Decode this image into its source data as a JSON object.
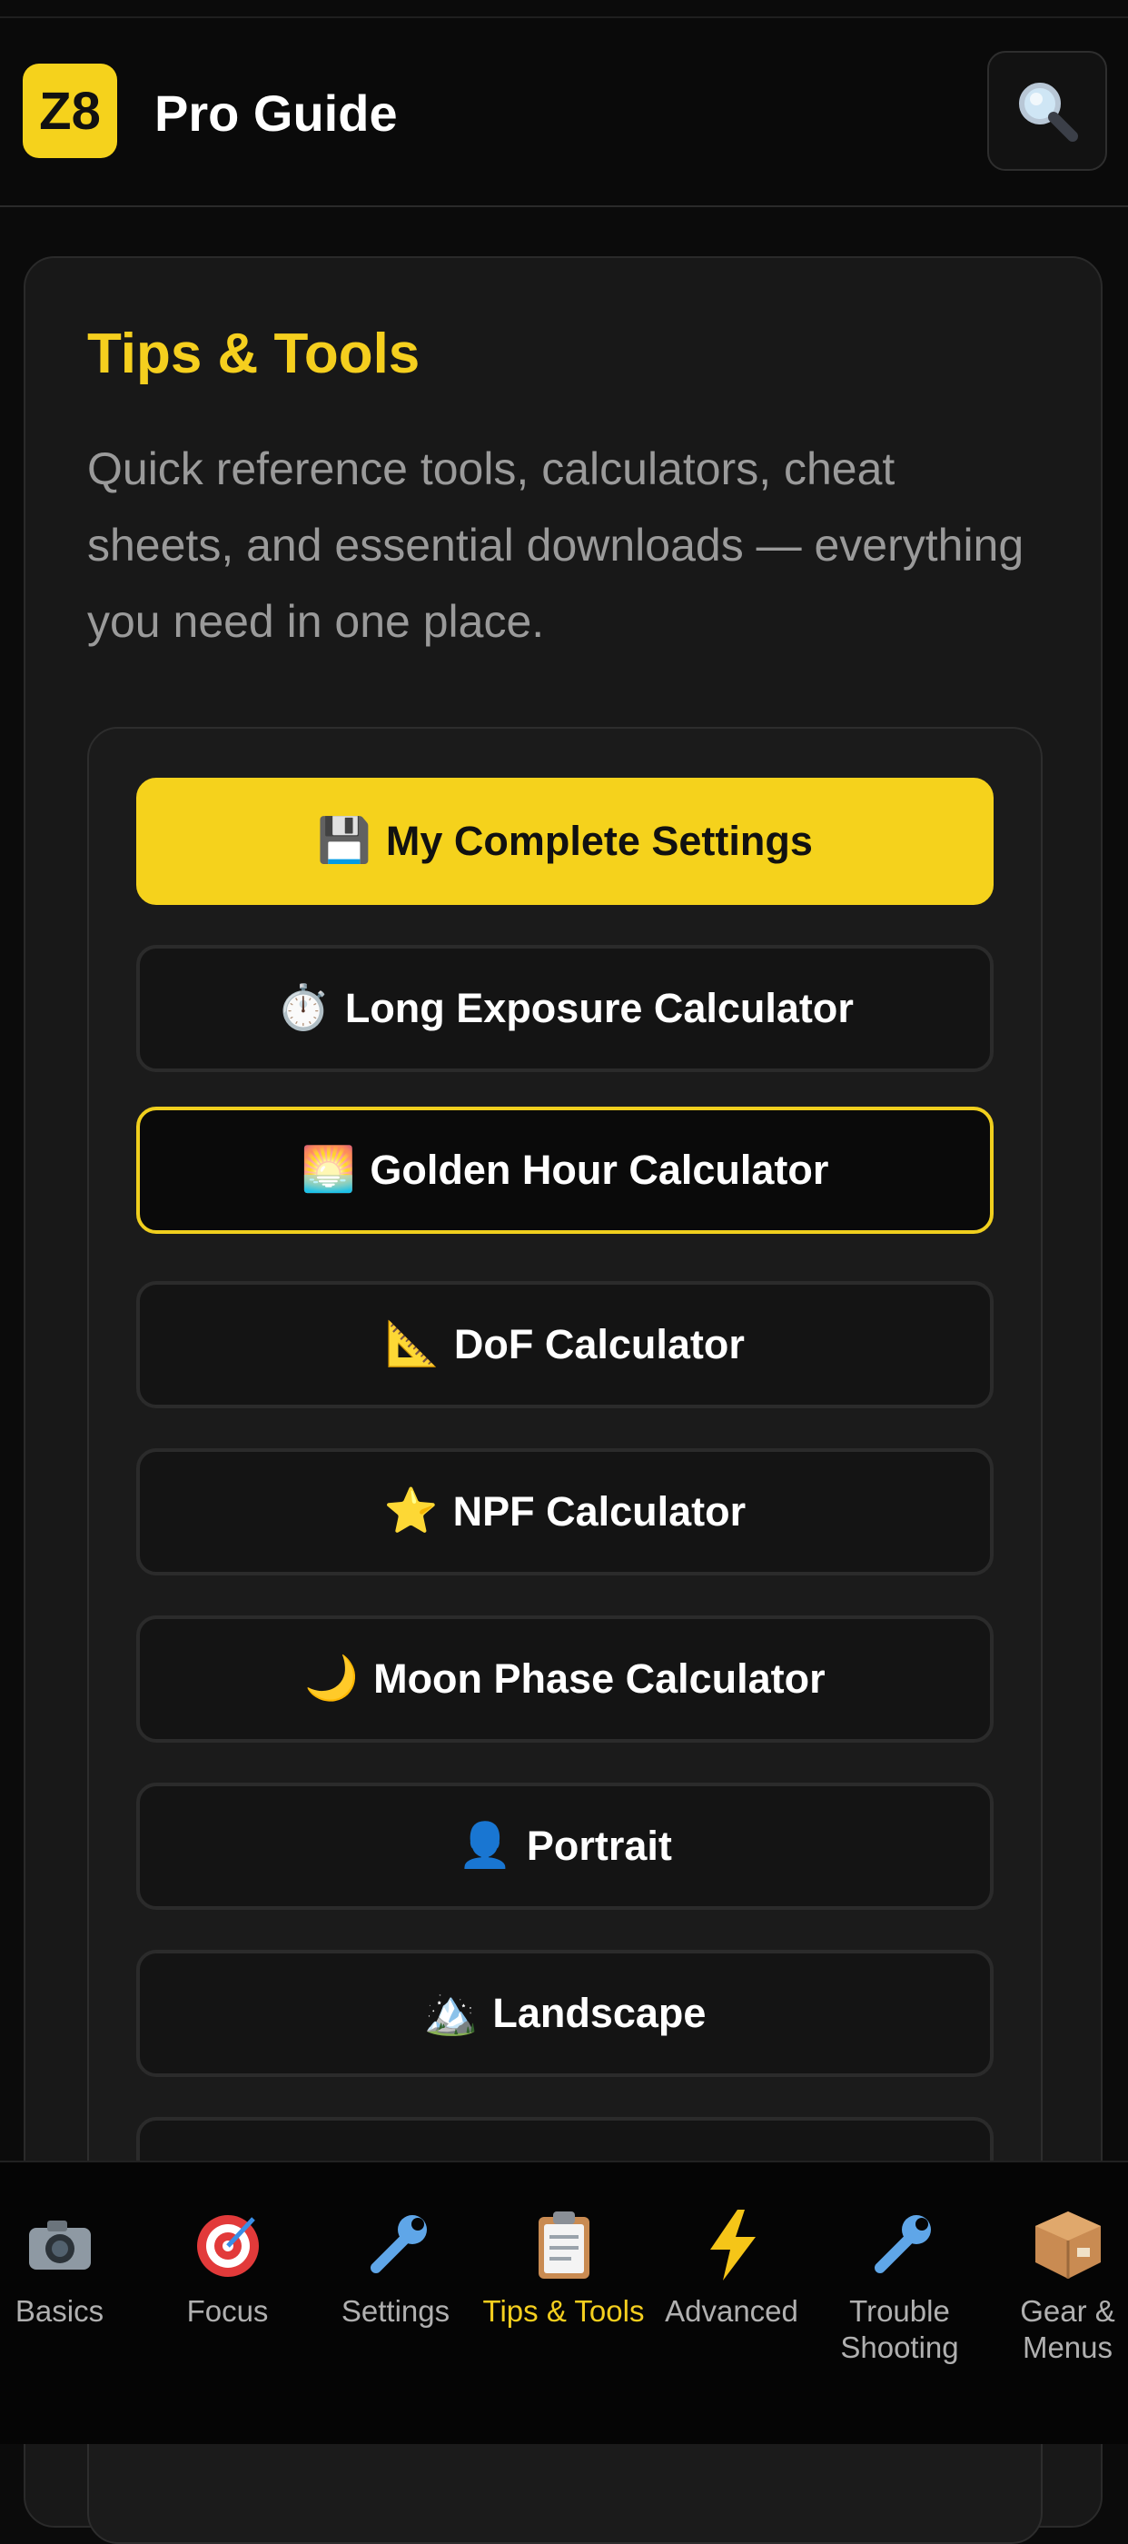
{
  "header": {
    "logo_text": "Z8",
    "title": "Pro Guide",
    "search_icon": "search-icon"
  },
  "card": {
    "title": "Tips & Tools",
    "description": "Quick reference tools, calculators, cheat sheets, and essential downloads — everything you need in one place.",
    "buttons": [
      {
        "icon": "💾",
        "label": "My Complete Settings",
        "style": "primary"
      },
      {
        "icon": "⏱️",
        "label": "Long Exposure Calculator",
        "style": "default"
      },
      {
        "icon": "🌅",
        "label": "Golden Hour Calculator",
        "style": "selected"
      },
      {
        "icon": "📐",
        "label": "DoF Calculator",
        "style": "default"
      },
      {
        "icon": "⭐",
        "label": "NPF Calculator",
        "style": "default"
      },
      {
        "icon": "🌙",
        "label": "Moon Phase Calculator",
        "style": "default"
      },
      {
        "icon": "👤",
        "label": "Portrait",
        "style": "default"
      },
      {
        "icon": "🏔️",
        "label": "Landscape",
        "style": "default"
      }
    ]
  },
  "tabs": [
    {
      "icon": "📷",
      "label": "Basics"
    },
    {
      "icon": "🎯",
      "label": "Focus"
    },
    {
      "icon": "🔧",
      "label": "Settings"
    },
    {
      "icon": "📋",
      "label": "Tips & Tools",
      "active": true
    },
    {
      "icon": "⚡",
      "label": "Advanced"
    },
    {
      "icon": "🔧",
      "label": "Trouble Shooting"
    },
    {
      "icon": "📦",
      "label": "Gear & Menus"
    }
  ],
  "colors": {
    "accent": "#f5d21c",
    "background": "#0b0b0b",
    "card": "#181818"
  }
}
